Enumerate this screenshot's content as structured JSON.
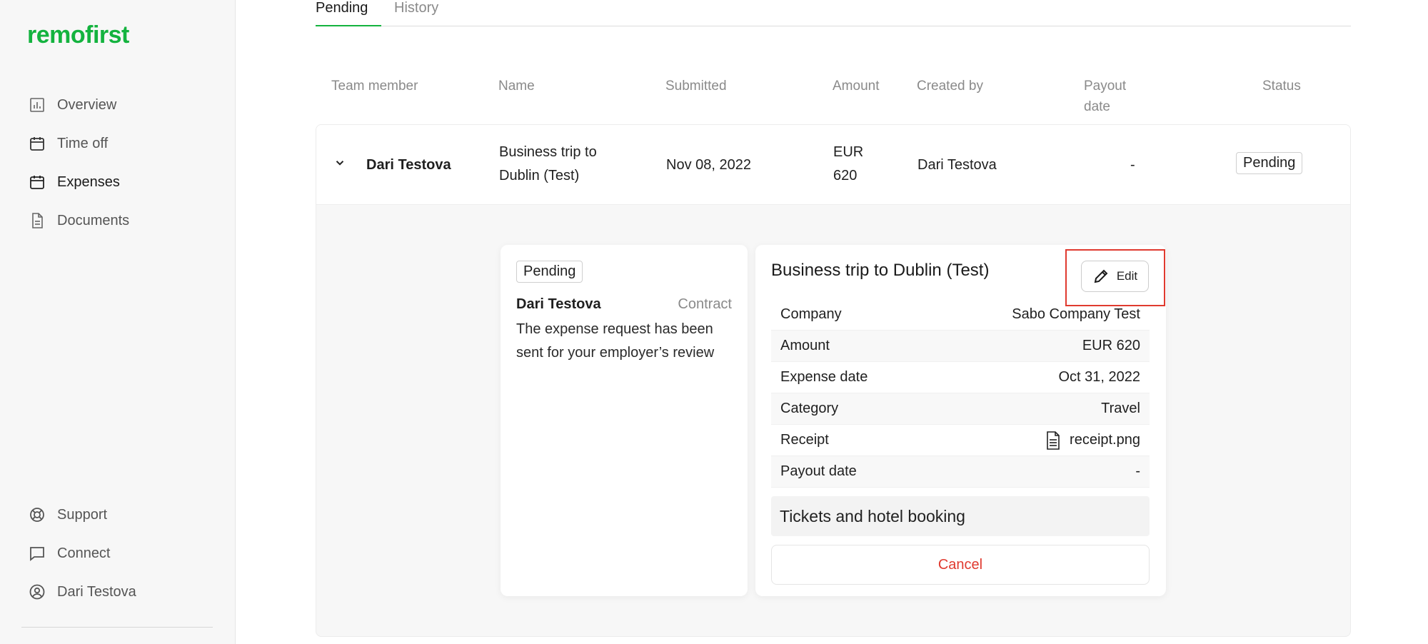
{
  "app": {
    "logo": "remofirst",
    "brand_color": "#14b33f",
    "danger_color": "#e03a2f"
  },
  "sidebar": {
    "items": [
      {
        "label": "Overview",
        "icon": "chart-icon"
      },
      {
        "label": "Time off",
        "icon": "calendar-icon"
      },
      {
        "label": "Expenses",
        "icon": "calendar-icon"
      },
      {
        "label": "Documents",
        "icon": "document-icon"
      }
    ],
    "bottom_items": [
      {
        "label": "Support",
        "icon": "lifebuoy-icon"
      },
      {
        "label": "Connect",
        "icon": "chat-icon"
      },
      {
        "label": "Dari Testova",
        "icon": "user-circle-icon"
      }
    ]
  },
  "tabs": [
    {
      "label": "Pending",
      "active": true
    },
    {
      "label": "History",
      "active": false
    }
  ],
  "table": {
    "headers": [
      "Team member",
      "Name",
      "Submitted",
      "Amount",
      "Created by",
      "Payout\ndate",
      "Status"
    ],
    "rows": [
      {
        "member": "Dari Testova",
        "name": "Business trip to\nDublin (Test)",
        "submitted": "Nov 08, 2022",
        "amount": "EUR\n620",
        "created_by": "Dari Testova",
        "payout_date": "-",
        "status": "Pending"
      }
    ]
  },
  "status_panel": {
    "badge": "Pending",
    "author": "Dari Testova",
    "role": "Contract",
    "message": "The expense request has been sent for your employer’s review"
  },
  "details": {
    "title": "Business trip to Dublin (Test)",
    "edit_label": "Edit",
    "fields": [
      {
        "label": "Company",
        "value": "Sabo Company Test"
      },
      {
        "label": "Amount",
        "value": "EUR 620"
      },
      {
        "label": "Expense date",
        "value": "Oct 31, 2022"
      },
      {
        "label": "Category",
        "value": "Travel"
      },
      {
        "label": "Receipt",
        "value": "receipt.png"
      },
      {
        "label": "Payout date",
        "value": "-"
      }
    ],
    "note": "Tickets and hotel booking",
    "cancel_label": "Cancel"
  }
}
